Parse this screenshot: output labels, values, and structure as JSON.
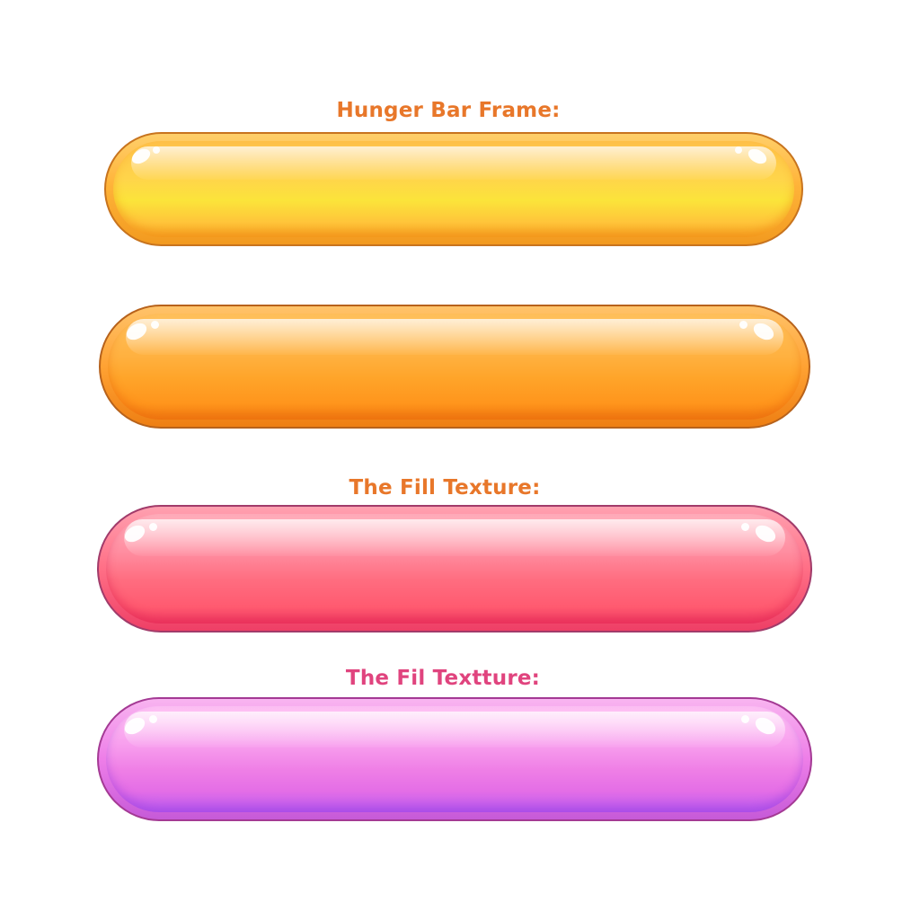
{
  "labels": {
    "frame_title": "Hunger Bar Frame:",
    "fill_texture_1": "The Fill Texture:",
    "fill_texture_2": "The Fil Textture:"
  },
  "bars": [
    {
      "name": "hunger-bar-frame-yellow",
      "color_main": "#ffc24a",
      "color_border": "#c8741e"
    },
    {
      "name": "hunger-bar-frame-orange",
      "color_main": "#ffa52a",
      "color_border": "#b7621b"
    },
    {
      "name": "fill-texture-pink",
      "color_main": "#ff6d80",
      "color_border": "#a13b6a"
    },
    {
      "name": "fill-texture-purple",
      "color_main": "#ef7fe6",
      "color_border": "#a43a94"
    }
  ],
  "colors": {
    "label_orange": "#e8772a",
    "label_pink": "#e0447e"
  }
}
